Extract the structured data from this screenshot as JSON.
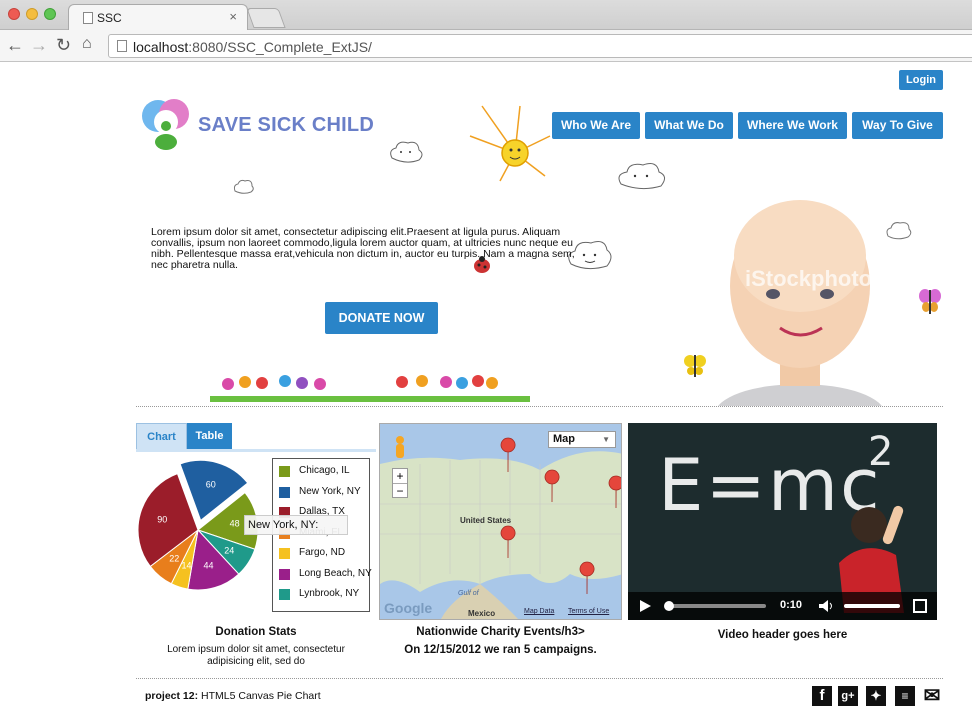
{
  "browser": {
    "tab_title": "SSC",
    "tab_close": "×",
    "url_host": "localhost",
    "url_path": ":8080/SSC_Complete_ExtJS/"
  },
  "header": {
    "login_label": "Login",
    "logo_text": "SAVE SICK CHILD",
    "nav": [
      "Who We Are",
      "What We Do",
      "Where We Work",
      "Way To Give"
    ]
  },
  "hero": {
    "intro": "Lorem ipsum dolor sit amet, consectetur adipiscing elit.Praesent at ligula purus. Aliquam convallis, ipsum non laoreet commodo,ligula lorem auctor quam, at ultricies nunc neque eu nibh. Pellentesque massa erat,vehicula non dictum in, auctor eu turpis. Nam a magna sem, nec pharetra nulla.",
    "donate_label": "DONATE NOW",
    "watermark": "iStockphoto"
  },
  "chart_panel": {
    "tab_chart": "Chart",
    "tab_table": "Table",
    "tooltip": "New York, NY:",
    "title": "Donation Stats",
    "description": "Lorem ipsum dolor sit amet, consectetur adipisicing elit, sed do"
  },
  "chart_data": {
    "type": "pie",
    "categories": [
      "Chicago, IL",
      "New York, NY",
      "Dallas, TX",
      "Miami, FL",
      "Fargo, ND",
      "Long Beach, NY",
      "Lynbrook, NY"
    ],
    "values": [
      48,
      60,
      90,
      22,
      14,
      44,
      24
    ],
    "colors": [
      "#7a9a1a",
      "#1f5fa0",
      "#9b1d2a",
      "#e87e1c",
      "#f5c120",
      "#9a1f8a",
      "#1f9a8a"
    ],
    "exploded": "New York, NY",
    "legend_position": "right"
  },
  "map_panel": {
    "map_type": "Map",
    "country_label": "United States",
    "mexico_label": "Mexico",
    "gulf_label": "Gulf of",
    "map_data": "Map Data",
    "terms": "Terms of Use",
    "google": "Google",
    "title_line1": "Nationwide Charity Events/h3>",
    "title_line2": "On 12/15/2012 we ran 5 campaigns."
  },
  "video_panel": {
    "chalk_text": "E=mc",
    "chalk_exponent": "2",
    "time": "0:10",
    "caption": "Video header goes here"
  },
  "footer": {
    "project_label": "project 12:",
    "project_text": "HTML5 Canvas Pie Chart",
    "social": [
      "f",
      "g+",
      "t",
      "rss",
      "mail"
    ]
  },
  "colors": {
    "accent": "#2a84c8"
  }
}
